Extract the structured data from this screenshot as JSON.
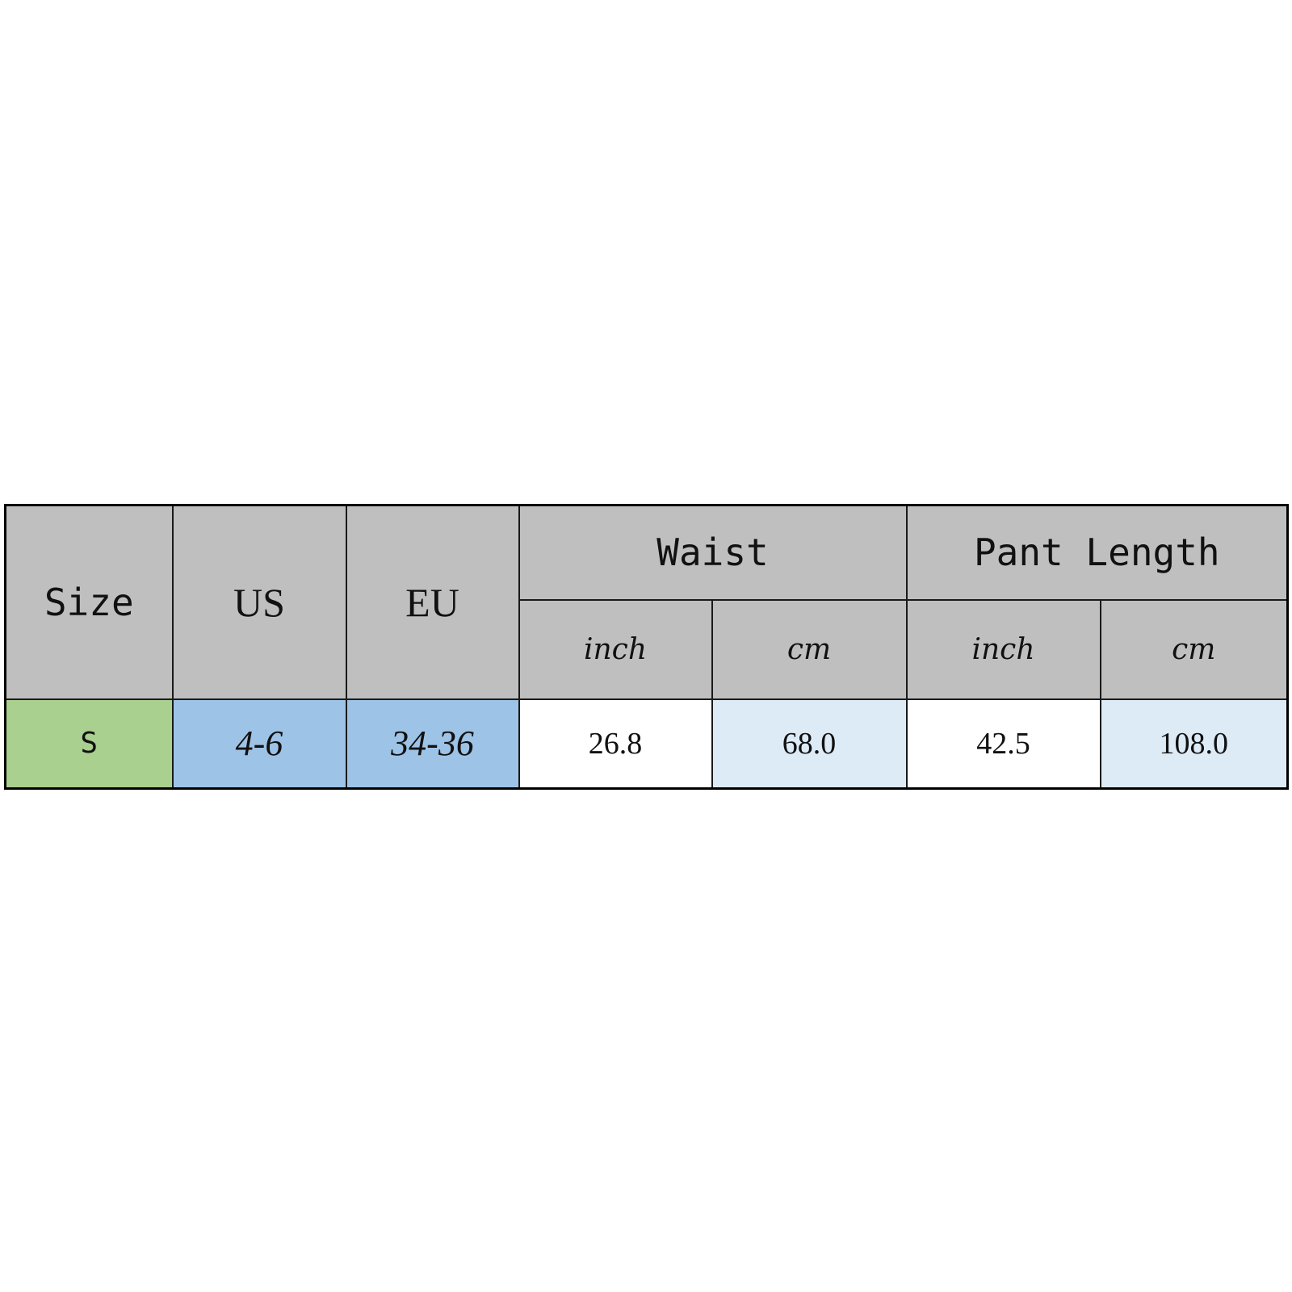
{
  "table": {
    "headers": {
      "size": "Size",
      "us": "US",
      "eu": "EU",
      "waist": "Waist",
      "pant_length": "Pant Length",
      "waist_inch": "inch",
      "waist_cm": "cm",
      "length_inch": "inch",
      "length_cm": "cm"
    },
    "rows": [
      {
        "size": "S",
        "us": "4-6",
        "eu": "34-36",
        "waist_inch": "26.8",
        "waist_cm": "68.0",
        "length_inch": "42.5",
        "length_cm": "108.0"
      }
    ]
  },
  "colors": {
    "header_bg": "#bfbfbf",
    "size_bg": "#a9d08e",
    "intl_bg": "#9dc3e6",
    "cm_bg": "#ddebf7",
    "inch_bg": "#ffffff"
  }
}
